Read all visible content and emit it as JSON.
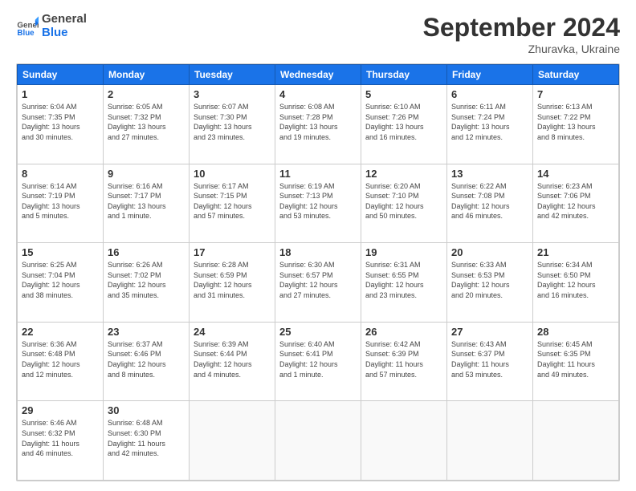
{
  "header": {
    "logo_general": "General",
    "logo_blue": "Blue",
    "month_title": "September 2024",
    "subtitle": "Zhuravka, Ukraine"
  },
  "days_of_week": [
    "Sunday",
    "Monday",
    "Tuesday",
    "Wednesday",
    "Thursday",
    "Friday",
    "Saturday"
  ],
  "weeks": [
    [
      {
        "day": "1",
        "lines": [
          "Sunrise: 6:04 AM",
          "Sunset: 7:35 PM",
          "Daylight: 13 hours",
          "and 30 minutes."
        ]
      },
      {
        "day": "2",
        "lines": [
          "Sunrise: 6:05 AM",
          "Sunset: 7:32 PM",
          "Daylight: 13 hours",
          "and 27 minutes."
        ]
      },
      {
        "day": "3",
        "lines": [
          "Sunrise: 6:07 AM",
          "Sunset: 7:30 PM",
          "Daylight: 13 hours",
          "and 23 minutes."
        ]
      },
      {
        "day": "4",
        "lines": [
          "Sunrise: 6:08 AM",
          "Sunset: 7:28 PM",
          "Daylight: 13 hours",
          "and 19 minutes."
        ]
      },
      {
        "day": "5",
        "lines": [
          "Sunrise: 6:10 AM",
          "Sunset: 7:26 PM",
          "Daylight: 13 hours",
          "and 16 minutes."
        ]
      },
      {
        "day": "6",
        "lines": [
          "Sunrise: 6:11 AM",
          "Sunset: 7:24 PM",
          "Daylight: 13 hours",
          "and 12 minutes."
        ]
      },
      {
        "day": "7",
        "lines": [
          "Sunrise: 6:13 AM",
          "Sunset: 7:22 PM",
          "Daylight: 13 hours",
          "and 8 minutes."
        ]
      }
    ],
    [
      {
        "day": "8",
        "lines": [
          "Sunrise: 6:14 AM",
          "Sunset: 7:19 PM",
          "Daylight: 13 hours",
          "and 5 minutes."
        ]
      },
      {
        "day": "9",
        "lines": [
          "Sunrise: 6:16 AM",
          "Sunset: 7:17 PM",
          "Daylight: 13 hours",
          "and 1 minute."
        ]
      },
      {
        "day": "10",
        "lines": [
          "Sunrise: 6:17 AM",
          "Sunset: 7:15 PM",
          "Daylight: 12 hours",
          "and 57 minutes."
        ]
      },
      {
        "day": "11",
        "lines": [
          "Sunrise: 6:19 AM",
          "Sunset: 7:13 PM",
          "Daylight: 12 hours",
          "and 53 minutes."
        ]
      },
      {
        "day": "12",
        "lines": [
          "Sunrise: 6:20 AM",
          "Sunset: 7:10 PM",
          "Daylight: 12 hours",
          "and 50 minutes."
        ]
      },
      {
        "day": "13",
        "lines": [
          "Sunrise: 6:22 AM",
          "Sunset: 7:08 PM",
          "Daylight: 12 hours",
          "and 46 minutes."
        ]
      },
      {
        "day": "14",
        "lines": [
          "Sunrise: 6:23 AM",
          "Sunset: 7:06 PM",
          "Daylight: 12 hours",
          "and 42 minutes."
        ]
      }
    ],
    [
      {
        "day": "15",
        "lines": [
          "Sunrise: 6:25 AM",
          "Sunset: 7:04 PM",
          "Daylight: 12 hours",
          "and 38 minutes."
        ]
      },
      {
        "day": "16",
        "lines": [
          "Sunrise: 6:26 AM",
          "Sunset: 7:02 PM",
          "Daylight: 12 hours",
          "and 35 minutes."
        ]
      },
      {
        "day": "17",
        "lines": [
          "Sunrise: 6:28 AM",
          "Sunset: 6:59 PM",
          "Daylight: 12 hours",
          "and 31 minutes."
        ]
      },
      {
        "day": "18",
        "lines": [
          "Sunrise: 6:30 AM",
          "Sunset: 6:57 PM",
          "Daylight: 12 hours",
          "and 27 minutes."
        ]
      },
      {
        "day": "19",
        "lines": [
          "Sunrise: 6:31 AM",
          "Sunset: 6:55 PM",
          "Daylight: 12 hours",
          "and 23 minutes."
        ]
      },
      {
        "day": "20",
        "lines": [
          "Sunrise: 6:33 AM",
          "Sunset: 6:53 PM",
          "Daylight: 12 hours",
          "and 20 minutes."
        ]
      },
      {
        "day": "21",
        "lines": [
          "Sunrise: 6:34 AM",
          "Sunset: 6:50 PM",
          "Daylight: 12 hours",
          "and 16 minutes."
        ]
      }
    ],
    [
      {
        "day": "22",
        "lines": [
          "Sunrise: 6:36 AM",
          "Sunset: 6:48 PM",
          "Daylight: 12 hours",
          "and 12 minutes."
        ]
      },
      {
        "day": "23",
        "lines": [
          "Sunrise: 6:37 AM",
          "Sunset: 6:46 PM",
          "Daylight: 12 hours",
          "and 8 minutes."
        ]
      },
      {
        "day": "24",
        "lines": [
          "Sunrise: 6:39 AM",
          "Sunset: 6:44 PM",
          "Daylight: 12 hours",
          "and 4 minutes."
        ]
      },
      {
        "day": "25",
        "lines": [
          "Sunrise: 6:40 AM",
          "Sunset: 6:41 PM",
          "Daylight: 12 hours",
          "and 1 minute."
        ]
      },
      {
        "day": "26",
        "lines": [
          "Sunrise: 6:42 AM",
          "Sunset: 6:39 PM",
          "Daylight: 11 hours",
          "and 57 minutes."
        ]
      },
      {
        "day": "27",
        "lines": [
          "Sunrise: 6:43 AM",
          "Sunset: 6:37 PM",
          "Daylight: 11 hours",
          "and 53 minutes."
        ]
      },
      {
        "day": "28",
        "lines": [
          "Sunrise: 6:45 AM",
          "Sunset: 6:35 PM",
          "Daylight: 11 hours",
          "and 49 minutes."
        ]
      }
    ],
    [
      {
        "day": "29",
        "lines": [
          "Sunrise: 6:46 AM",
          "Sunset: 6:32 PM",
          "Daylight: 11 hours",
          "and 46 minutes."
        ]
      },
      {
        "day": "30",
        "lines": [
          "Sunrise: 6:48 AM",
          "Sunset: 6:30 PM",
          "Daylight: 11 hours",
          "and 42 minutes."
        ]
      },
      {
        "day": "",
        "lines": []
      },
      {
        "day": "",
        "lines": []
      },
      {
        "day": "",
        "lines": []
      },
      {
        "day": "",
        "lines": []
      },
      {
        "day": "",
        "lines": []
      }
    ]
  ]
}
